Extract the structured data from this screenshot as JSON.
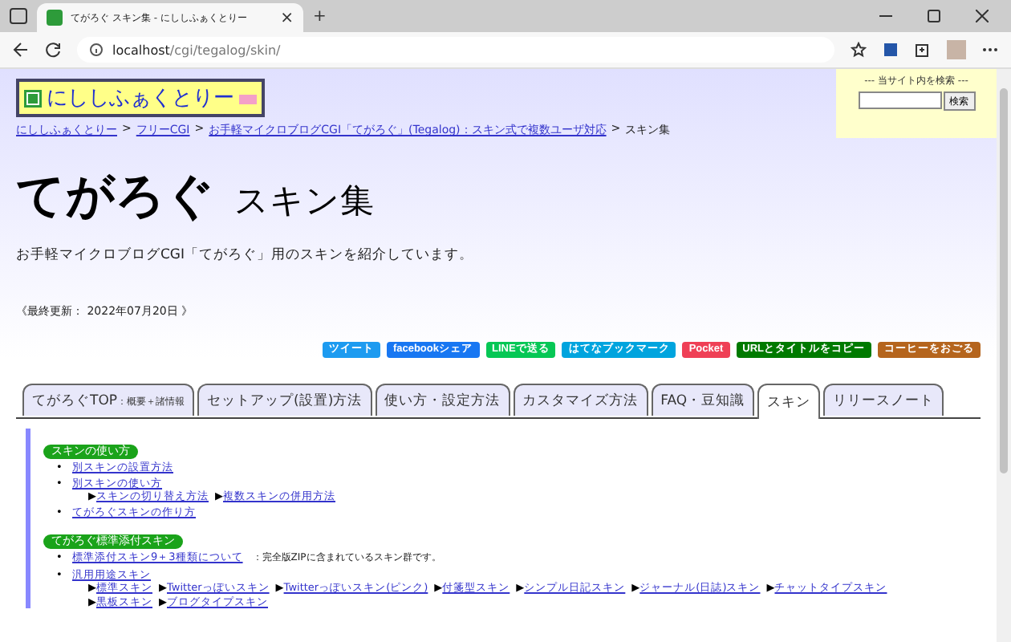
{
  "browser": {
    "tab_title": "てがろぐ スキン集 - にししふぁくとりー",
    "tab_close": "×",
    "new_tab": "+",
    "url_host": "localhost",
    "url_path": "/cgi/tegalog/skin/"
  },
  "logo": {
    "text": "にししふぁくとりー"
  },
  "site_search": {
    "title": "--- 当サイト内を検索 ---",
    "button": "検索"
  },
  "breadcrumb": [
    {
      "label": "にししふぁくとりー",
      "link": true
    },
    {
      "label": "フリーCGI",
      "link": true
    },
    {
      "label": "お手軽マイクロブログCGI「てがろぐ」(Tegalog)：スキン式で複数ユーザ対応",
      "link": true
    },
    {
      "label": "スキン集",
      "link": false
    }
  ],
  "breadcrumb_separator": ">",
  "heading": {
    "main": "てがろぐ",
    "sub": "スキン集"
  },
  "intro": "お手軽マイクロブログCGI「てがろぐ」用のスキンを紹介しています。",
  "updated": "《最終更新： 2022年07月20日 》",
  "share_buttons": [
    {
      "label": "ツイート",
      "color": "#1d9bf0"
    },
    {
      "label": "facebookシェア",
      "color": "#1877f2"
    },
    {
      "label": "LINEで送る",
      "color": "#06c755"
    },
    {
      "label": "はてなブックマーク",
      "color": "#00a4de"
    },
    {
      "label": "Pocket",
      "color": "#ef4056"
    },
    {
      "label": "URLとタイトルをコピー",
      "color": "#007a00"
    },
    {
      "label": "コーヒーをおごる",
      "color": "#b5651d"
    }
  ],
  "nav_tabs": [
    {
      "label": "てがろぐTOP",
      "small": "：概要＋諸情報",
      "selected": false
    },
    {
      "label": "セットアップ(設置)方法",
      "selected": false
    },
    {
      "label": "使い方・設定方法",
      "selected": false
    },
    {
      "label": "カスタマイズ方法",
      "selected": false
    },
    {
      "label": "FAQ・豆知識",
      "selected": false
    },
    {
      "label": "スキン",
      "selected": true
    },
    {
      "label": "リリースノート",
      "selected": false
    }
  ],
  "sections": [
    {
      "title": "スキンの使い方",
      "bullet": "•",
      "items": [
        {
          "label": "別スキンの設置方法"
        },
        {
          "label": "別スキンの使い方",
          "sublinks": [
            {
              "marker": "▶",
              "label": "スキンの切り替え方法"
            },
            {
              "marker": "▶",
              "label": "複数スキンの併用方法"
            }
          ]
        },
        {
          "label": "てがろぐスキンの作り方"
        }
      ]
    },
    {
      "title": "てがろぐ標準添付スキン",
      "bullet": "•",
      "items": [
        {
          "label": "標準添付スキン9＋3種類について",
          "note": "：完全版ZIPに含まれているスキン群です。"
        },
        {
          "label": "汎用用途スキン",
          "sublinks": [
            {
              "marker": "▶",
              "label": "標準スキン"
            },
            {
              "marker": "▶",
              "label": "Twitterっぽいスキン"
            },
            {
              "marker": "▶",
              "label": "Twitterっぽいスキン(ピンク)"
            },
            {
              "marker": "▶",
              "label": "付箋型スキン"
            },
            {
              "marker": "▶",
              "label": "シンプル日記スキン"
            },
            {
              "marker": "▶",
              "label": "ジャーナル(日誌)スキン"
            },
            {
              "marker": "▶",
              "label": "チャットタイプスキン"
            },
            {
              "marker": "▶",
              "label": "黒板スキン"
            },
            {
              "marker": "▶",
              "label": "ブログタイプスキン"
            }
          ]
        }
      ]
    }
  ]
}
